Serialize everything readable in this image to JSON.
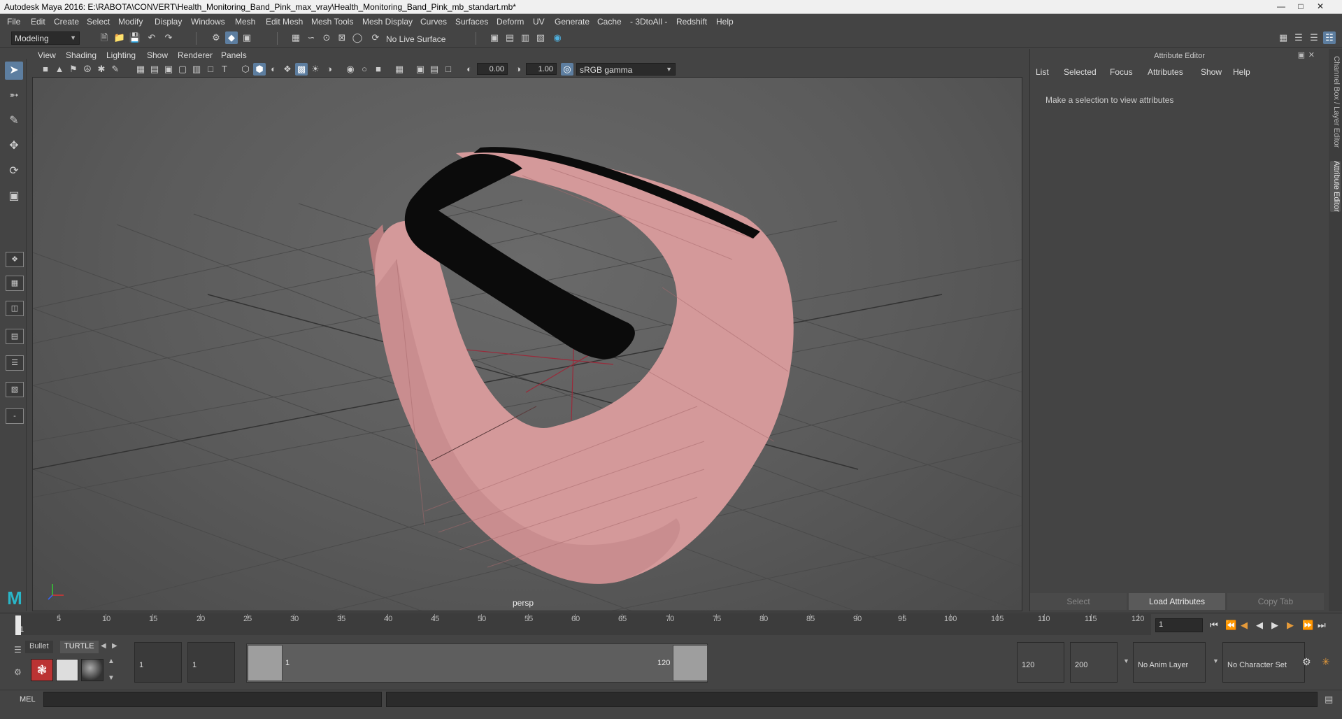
{
  "window": {
    "title": "Autodesk Maya 2016: E:\\RABOTA\\CONVERT\\Health_Monitoring_Band_Pink_max_vray\\Health_Monitoring_Band_Pink_mb_standart.mb*"
  },
  "menubar": [
    "File",
    "Edit",
    "Create",
    "Select",
    "Modify",
    "Display",
    "Windows",
    "Mesh",
    "Edit Mesh",
    "Mesh Tools",
    "Mesh Display",
    "Curves",
    "Surfaces",
    "Deform",
    "UV",
    "Generate",
    "Cache",
    "- 3DtoAll -",
    "Redshift",
    "Help"
  ],
  "statusline": {
    "mode": "Modeling",
    "live_surface": "No Live Surface"
  },
  "panel_menu": [
    "View",
    "Shading",
    "Lighting",
    "Show",
    "Renderer",
    "Panels"
  ],
  "viewport_toolbar": {
    "exposure": "0.00",
    "gamma": "1.00",
    "color_space": "sRGB gamma"
  },
  "viewport": {
    "camera": "persp",
    "band_color": "#d4999a",
    "tracker_color": "#0b0b0b"
  },
  "attribute_editor": {
    "title": "Attribute Editor",
    "menu": [
      "List",
      "Selected",
      "Focus",
      "Attributes",
      "Show",
      "Help"
    ],
    "message": "Make a selection to view attributes",
    "buttons": {
      "select": "Select",
      "load": "Load Attributes",
      "copy": "Copy Tab"
    }
  },
  "side_tabs": {
    "channel_box": "Channel Box / Layer Editor",
    "attribute_editor": "Attribute Editor"
  },
  "time_slider": {
    "ticks": [
      "5",
      "10",
      "15",
      "20",
      "25",
      "30",
      "35",
      "40",
      "45",
      "50",
      "55",
      "60",
      "65",
      "70",
      "75",
      "80",
      "85",
      "90",
      "95",
      "100",
      "105",
      "110",
      "115",
      "120"
    ],
    "current_frame": "1",
    "current_field": "1"
  },
  "shelf": {
    "tabs": [
      "Bullet",
      "TURTLE"
    ]
  },
  "range": {
    "start": "1",
    "playback_start": "1",
    "range_start_label": "1",
    "range_end_label": "120",
    "playback_end": "120",
    "end": "200",
    "anim_layer": "No Anim Layer",
    "char_set": "No Character Set"
  },
  "command_line": {
    "label": "MEL"
  }
}
